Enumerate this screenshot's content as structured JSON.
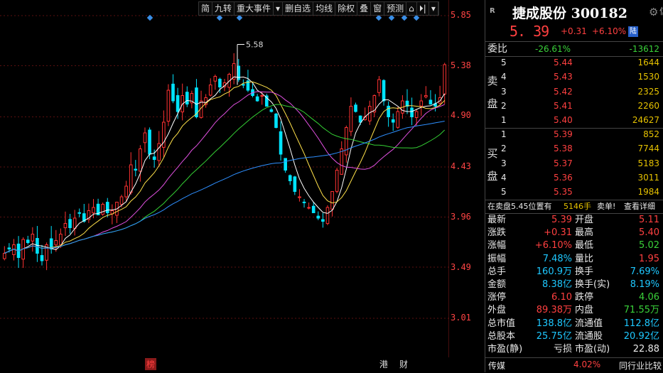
{
  "toolbar": [
    "简",
    "九转",
    "重大事件",
    "▾",
    "删自选",
    "均线",
    "除权",
    "叠",
    "窗",
    "预测",
    "⌂",
    "⏵|",
    "▾"
  ],
  "y_axis": [
    "5.85",
    "5.38",
    "4.90",
    "4.43",
    "3.96",
    "3.49",
    "3.01"
  ],
  "annotation": {
    "peak": "5.58"
  },
  "bottom_tags": [
    {
      "label": "榜",
      "red": true
    },
    {
      "label": "港",
      "red": false
    },
    {
      "label": "财",
      "red": false
    }
  ],
  "panel": {
    "badge": "R",
    "name": "捷成股份 300182",
    "gear_trail": "信",
    "price": "5. 39",
    "change": "+0.31",
    "change_pct": "+6.10%",
    "market_tag": "陆",
    "weibi": {
      "label": "委比",
      "pct": "-26.61%",
      "diff": "-13612"
    },
    "sell_label": [
      "卖",
      "盘"
    ],
    "buy_label": [
      "买",
      "盘"
    ],
    "sell": [
      {
        "lvl": "5",
        "price": "5.44",
        "vol": "1644"
      },
      {
        "lvl": "4",
        "price": "5.43",
        "vol": "1530"
      },
      {
        "lvl": "3",
        "price": "5.42",
        "vol": "2325"
      },
      {
        "lvl": "2",
        "price": "5.41",
        "vol": "2260"
      },
      {
        "lvl": "1",
        "price": "5.40",
        "vol": "24627"
      }
    ],
    "buy": [
      {
        "lvl": "1",
        "price": "5.39",
        "vol": "852"
      },
      {
        "lvl": "2",
        "price": "5.38",
        "vol": "7744"
      },
      {
        "lvl": "3",
        "price": "5.37",
        "vol": "5183"
      },
      {
        "lvl": "4",
        "price": "5.36",
        "vol": "3011"
      },
      {
        "lvl": "5",
        "price": "5.35",
        "vol": "1984"
      }
    ],
    "notice": {
      "text": "在卖盘5.45位置有",
      "vol": "5146手",
      "action": "卖单!",
      "link": "查看详细"
    },
    "stats": [
      {
        "l1": "最新",
        "v1": "5.39",
        "c1": "red",
        "l2": "开盘",
        "v2": "5.11",
        "c2": "red"
      },
      {
        "l1": "涨跌",
        "v1": "+0.31",
        "c1": "red",
        "l2": "最高",
        "v2": "5.40",
        "c2": "red"
      },
      {
        "l1": "涨幅",
        "v1": "+6.10%",
        "c1": "red",
        "l2": "最低",
        "v2": "5.02",
        "c2": "green"
      },
      {
        "l1": "振幅",
        "v1": "7.48%",
        "c1": "cyan",
        "l2": "量比",
        "v2": "1.95",
        "c2": "red"
      },
      {
        "l1": "总手",
        "v1": "160.9万",
        "c1": "cyan",
        "l2": "换手",
        "v2": "7.69%",
        "c2": "cyan"
      },
      {
        "l1": "金额",
        "v1": "8.38亿",
        "c1": "cyan",
        "l2": "换手(实)",
        "v2": "8.19%",
        "c2": "cyan"
      },
      {
        "l1": "涨停",
        "v1": "6.10",
        "c1": "red",
        "l2": "跌停",
        "v2": "4.06",
        "c2": "green"
      },
      {
        "l1": "外盘",
        "v1": "89.38万",
        "c1": "red",
        "l2": "内盘",
        "v2": "71.55万",
        "c2": "green"
      },
      {
        "l1": "总市值",
        "v1": "138.8亿",
        "c1": "cyan",
        "l2": "流通值",
        "v2": "112.8亿",
        "c2": "cyan"
      },
      {
        "l1": "总股本",
        "v1": "25.75亿",
        "c1": "cyan",
        "l2": "流通股",
        "v2": "20.92亿",
        "c2": "cyan"
      },
      {
        "l1": "市盈(静)",
        "v1": "亏损",
        "c1": "white",
        "l2": "市盈(动)",
        "v2": "22.88",
        "c2": "white"
      }
    ],
    "bottom": {
      "sector": "传媒",
      "pct": "4.02%",
      "compare": "同行业比较"
    }
  }
}
